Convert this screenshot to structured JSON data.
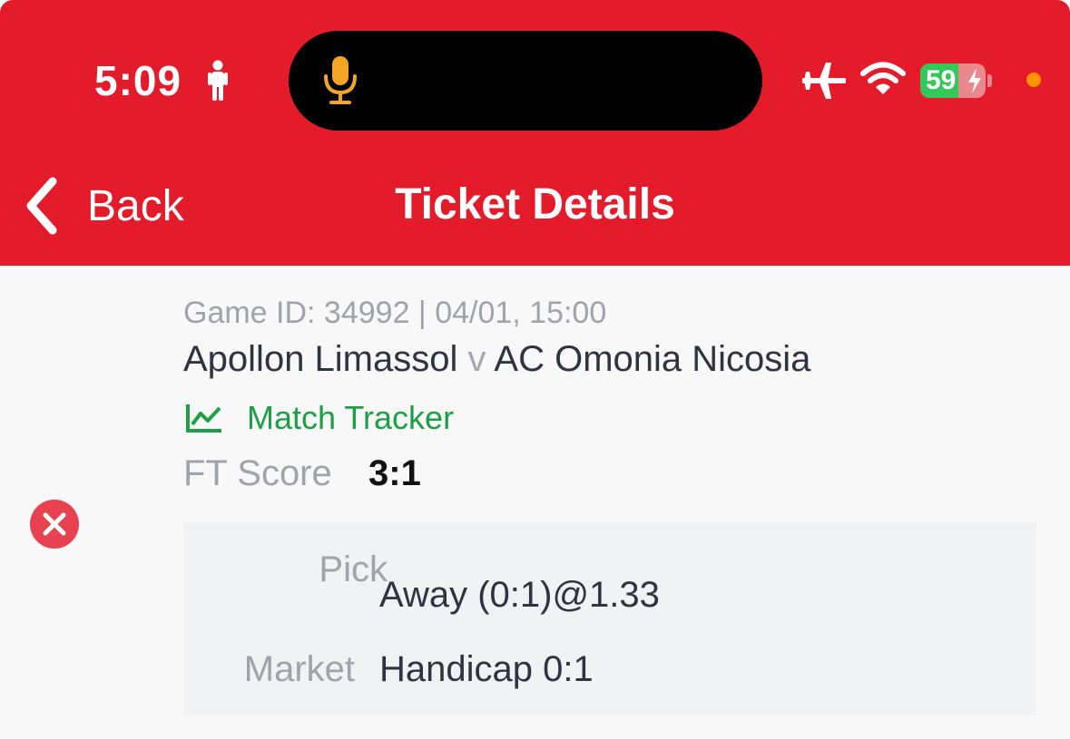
{
  "status_bar": {
    "time": "5:09",
    "battery": "59",
    "battery_percent": 59,
    "icons": [
      "person-icon",
      "microphone-icon",
      "airplane-icon",
      "wifi-icon",
      "battery-icon",
      "charging-bolt-icon"
    ]
  },
  "colors": {
    "header_bg": "#e31b2b",
    "mic": "#f5a524",
    "battery_fill": "#34c759",
    "battery_empty": "#e9888f",
    "tracker_green": "#1e9e46",
    "lost_red": "#e8414f",
    "privacy_dot": "#ff9500"
  },
  "nav": {
    "back_label": "Back",
    "title": "Ticket Details"
  },
  "game": {
    "meta": "Game ID: 34992 | 04/01, 15:00",
    "home": "Apollon Limassol",
    "separator": "v",
    "away": "AC Omonia Nicosia",
    "tracker_label": "Match Tracker",
    "score_label": "FT Score",
    "score_value": "3:1",
    "result_icon": "lost-icon"
  },
  "bet": {
    "pick_label": "Pick",
    "pick_value": "Away (0:1)@1.33",
    "market_label": "Market",
    "market_value": "Handicap 0:1"
  }
}
